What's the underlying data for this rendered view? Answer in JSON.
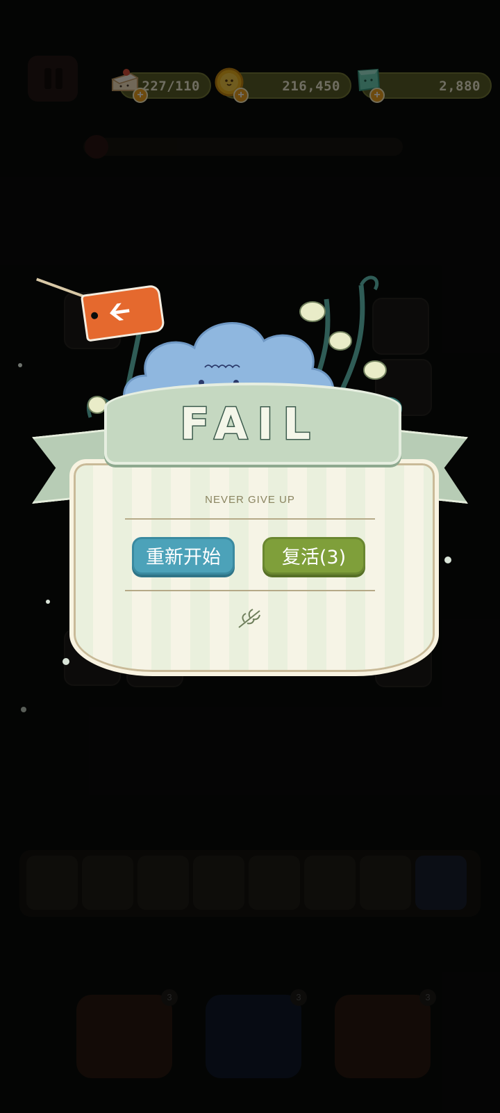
{
  "hud": {
    "lives": "227/110",
    "coins": "216,450",
    "gems": "2,880",
    "plus_symbol": "+"
  },
  "dialog": {
    "title": "FAIL",
    "subtitle": "NEVER GIVE UP",
    "restart_label": "重新开始",
    "revive_label": "复活(3)"
  },
  "boosters": {
    "undo_count": "3",
    "shuffle_count": "3",
    "hint_count": "3"
  },
  "colors": {
    "restart_button": "#4ca2b9",
    "revive_button": "#7f9f3a",
    "back_tag": "#e5692e"
  }
}
